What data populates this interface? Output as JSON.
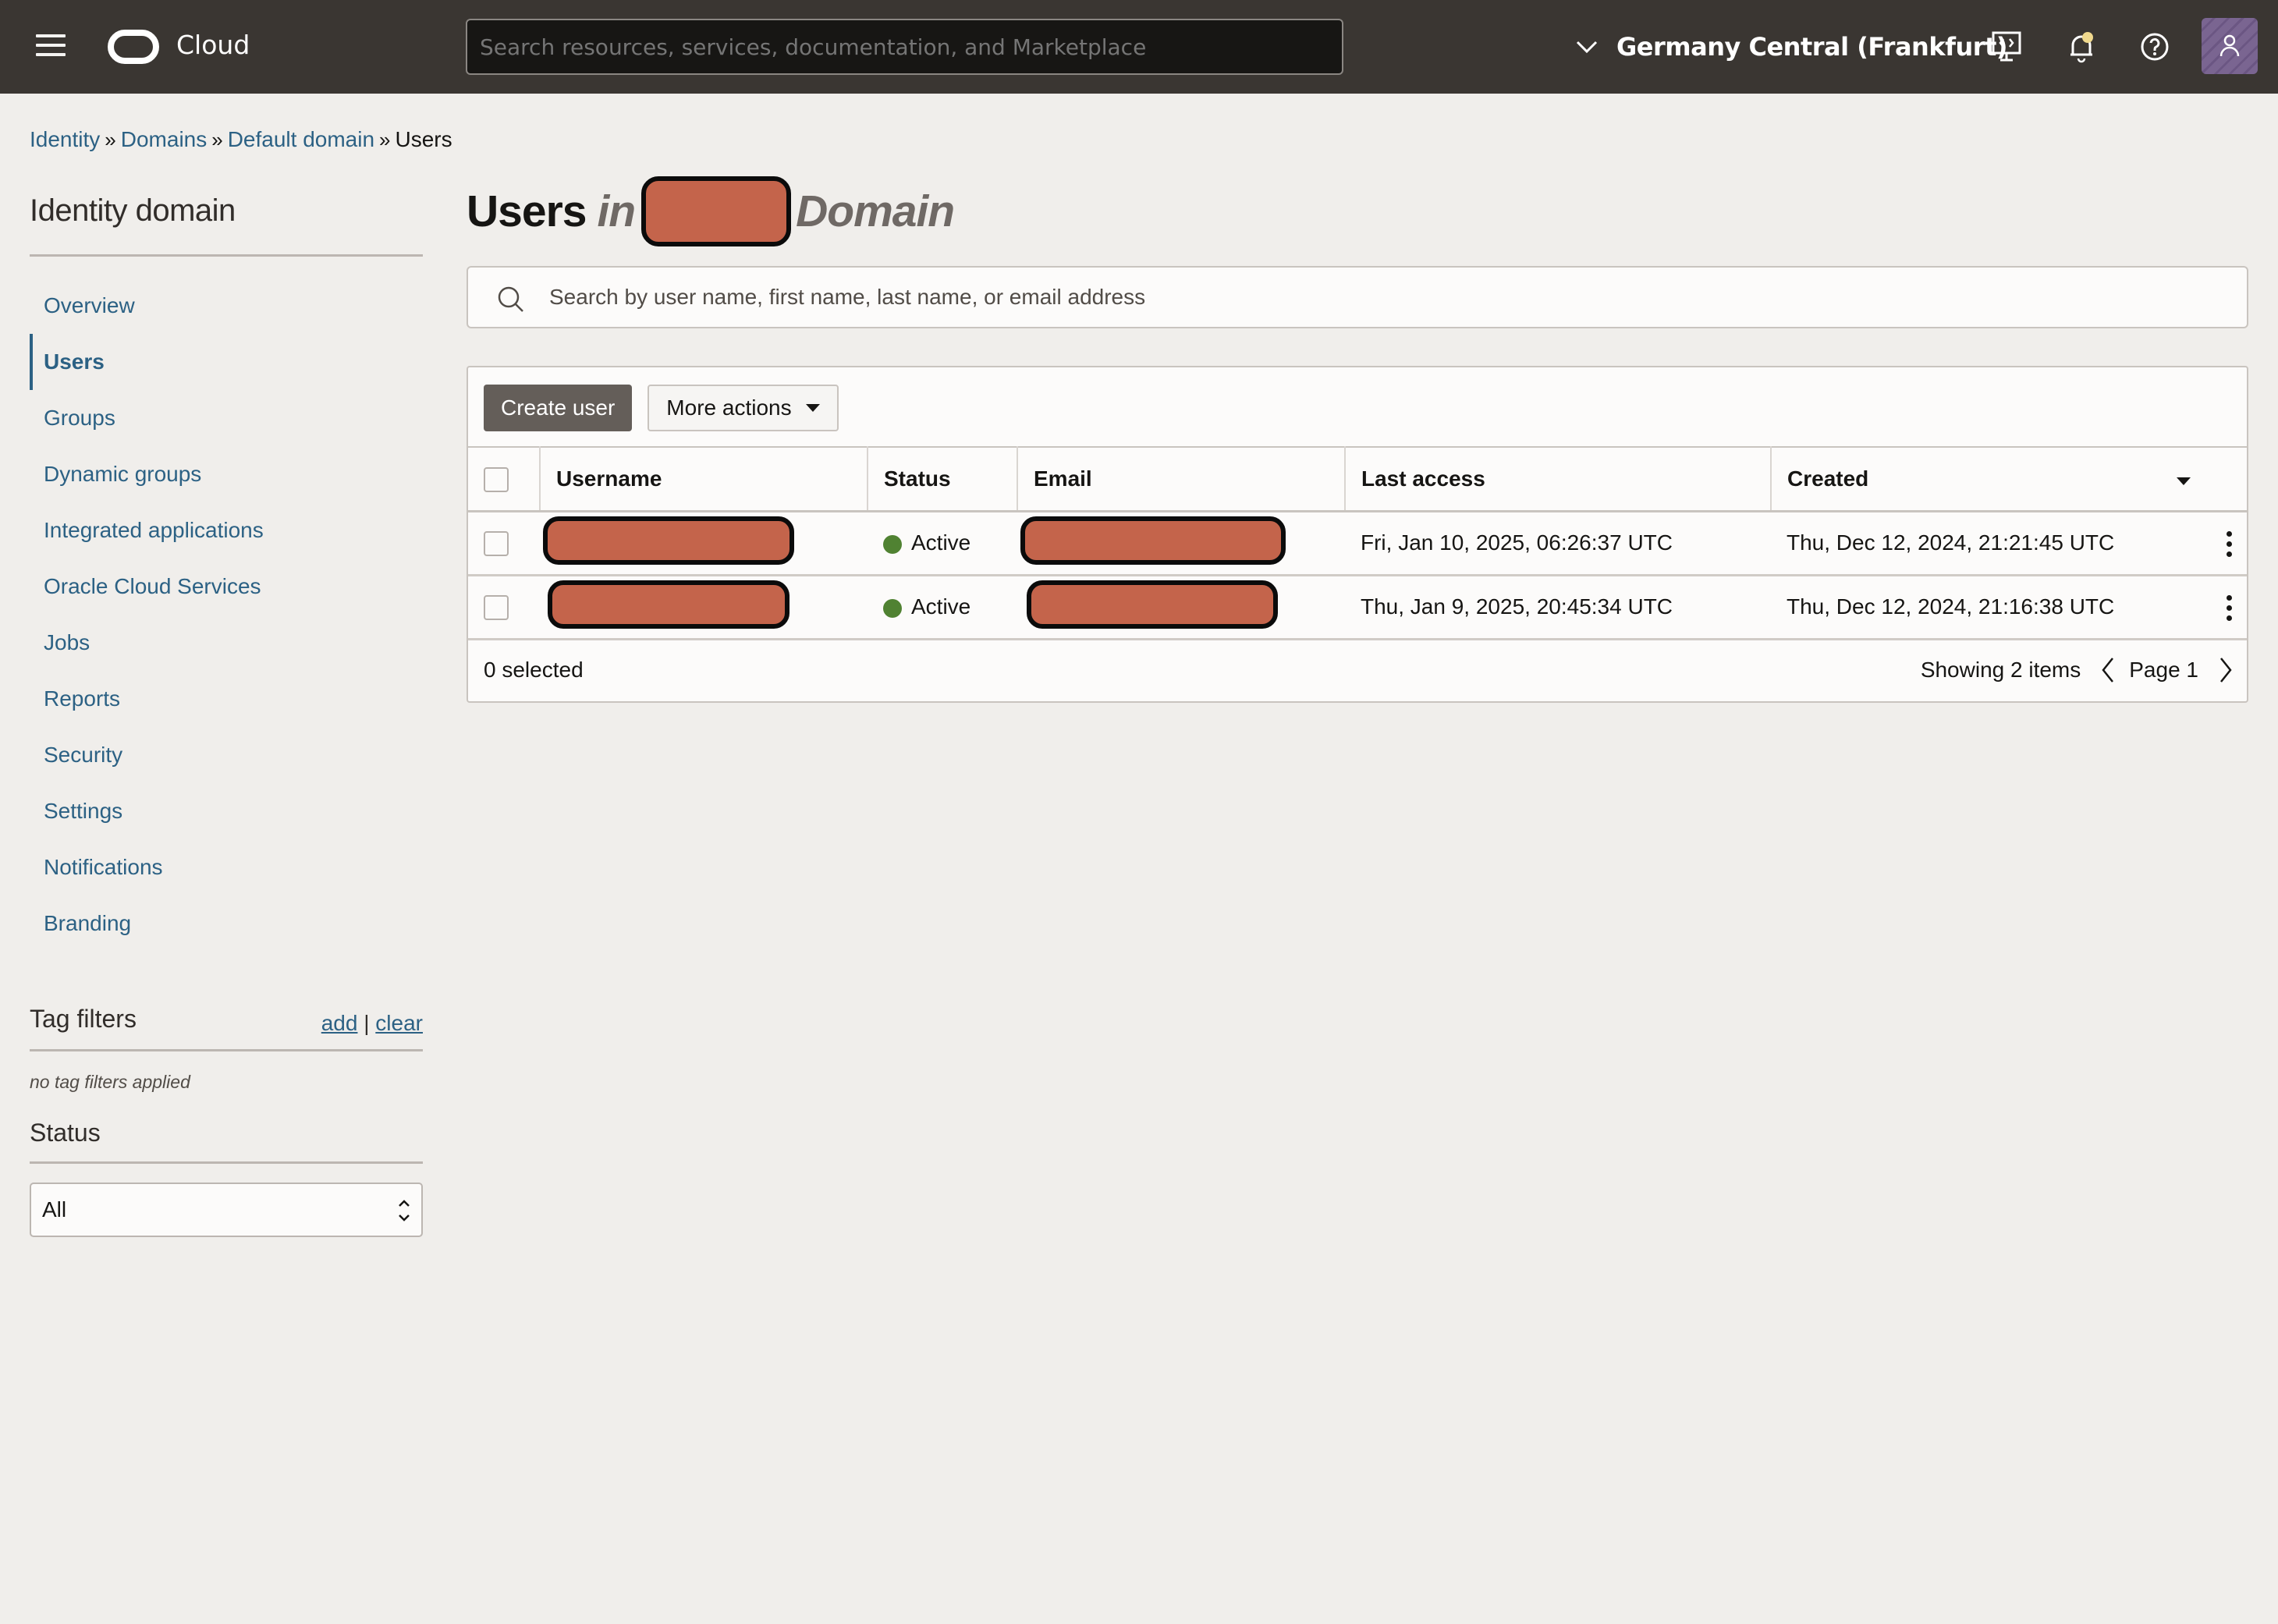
{
  "topbar": {
    "brand": "Cloud",
    "search_placeholder": "Search resources, services, documentation, and Marketplace",
    "region": "Germany Central (Frankfurt)",
    "icons": [
      "menu-icon",
      "oracle-logo-icon",
      "chevron-down-icon",
      "developer-tools-icon",
      "notifications-bell-icon",
      "help-icon",
      "user-profile-icon"
    ]
  },
  "breadcrumb": {
    "items": [
      {
        "label": "Identity",
        "link": true
      },
      {
        "label": "Domains",
        "link": true
      },
      {
        "label": "Default domain",
        "link": true
      },
      {
        "label": "Users",
        "link": false
      }
    ],
    "separator": "»"
  },
  "sidebar": {
    "title": "Identity domain",
    "items": [
      {
        "label": "Overview",
        "active": false
      },
      {
        "label": "Users",
        "active": true
      },
      {
        "label": "Groups",
        "active": false
      },
      {
        "label": "Dynamic groups",
        "active": false
      },
      {
        "label": "Integrated applications",
        "active": false
      },
      {
        "label": "Oracle Cloud Services",
        "active": false
      },
      {
        "label": "Jobs",
        "active": false
      },
      {
        "label": "Reports",
        "active": false
      },
      {
        "label": "Security",
        "active": false
      },
      {
        "label": "Settings",
        "active": false
      },
      {
        "label": "Notifications",
        "active": false
      },
      {
        "label": "Branding",
        "active": false
      }
    ],
    "tag_filters": {
      "title": "Tag filters",
      "add_label": "add",
      "separator": "|",
      "clear_label": "clear",
      "empty_text": "no tag filters applied"
    },
    "status_filter": {
      "title": "Status",
      "selected": "All"
    }
  },
  "main": {
    "title_prefix": "Users",
    "title_in": "in",
    "title_suffix": "Domain",
    "title_redacted": true,
    "search_placeholder": "Search by user name, first name, last name, or email address",
    "toolbar": {
      "create_label": "Create user",
      "more_actions_label": "More actions"
    },
    "table": {
      "columns": [
        "Username",
        "Status",
        "Email",
        "Last access",
        "Created"
      ],
      "sort_column": "Created",
      "sort_direction": "descending",
      "rows": [
        {
          "username": "[redacted]",
          "status": "Active",
          "email": "[redacted]",
          "last_access": "Fri, Jan 10, 2025, 06:26:37 UTC",
          "created": "Thu, Dec 12, 2024, 21:21:45 UTC"
        },
        {
          "username": "[redacted]",
          "status": "Active",
          "email": "[redacted]",
          "last_access": "Thu, Jan 9, 2025, 20:45:34 UTC",
          "created": "Thu, Dec 12, 2024, 21:16:38 UTC"
        }
      ]
    },
    "footer": {
      "selected_text": "0 selected",
      "showing_text": "Showing 2 items",
      "page_text": "Page 1"
    }
  },
  "colors": {
    "topbar_bg": "#3a3632",
    "link": "#2c6184",
    "active_status": "#508232",
    "primary_button": "#645e59",
    "redaction": "#c4644b",
    "page_bg": "#f0eeeb"
  }
}
